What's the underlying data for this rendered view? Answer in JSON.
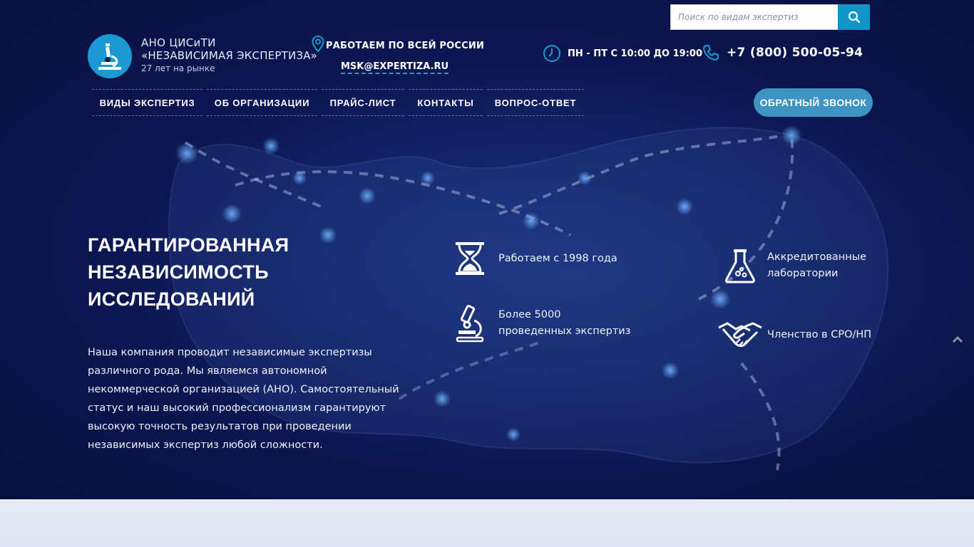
{
  "search": {
    "placeholder": "Поиск по видам экспертиз"
  },
  "logo": {
    "line1": "АНО ЦИСиТИ",
    "line2": "«НЕЗАВИСИМАЯ ЭКСПЕРТИЗА»",
    "line3": "27 лет на рынке"
  },
  "header": {
    "region": "РАБОТАЕМ ПО ВСЕЙ РОССИИ",
    "email": "MSK@EXPERTIZA.RU",
    "hours": "ПН - ПТ С 10:00 ДО 19:00",
    "phone": "+7 (800) 500-05-94"
  },
  "nav": {
    "items": [
      "ВИДЫ ЭКСПЕРТИЗ",
      "ОБ ОРГАНИЗАЦИИ",
      "ПРАЙС-ЛИСТ",
      "КОНТАКТЫ",
      "ВОПРОС-ОТВЕТ"
    ],
    "callback": "ОБРАТНЫЙ ЗВОНОК"
  },
  "hero": {
    "title": "ГАРАНТИРОВАННАЯ НЕЗАВИСИМОСТЬ ИССЛЕДОВАНИЙ",
    "description": "Наша компания проводит независимые экспертизы различного рода. Мы являемся автономной некоммерческой организацией (АНО). Самостоятельный статус и наш высокий профессионализм гарантируют высокую точность результатов при проведении независимых экспертиз любой сложности."
  },
  "features": [
    {
      "icon": "hourglass-icon",
      "label": "Работаем с 1998 года"
    },
    {
      "icon": "flask-icon",
      "label": "Аккредитованные лаборатории"
    },
    {
      "icon": "microscope-icon",
      "label": "Более 5000 проведенных экспертиз"
    },
    {
      "icon": "handshake-icon",
      "label": "Членство в СРО/НП"
    }
  ],
  "colors": {
    "background": "#0b1650",
    "accent": "#1195c9",
    "callback": "#3d93c2"
  }
}
